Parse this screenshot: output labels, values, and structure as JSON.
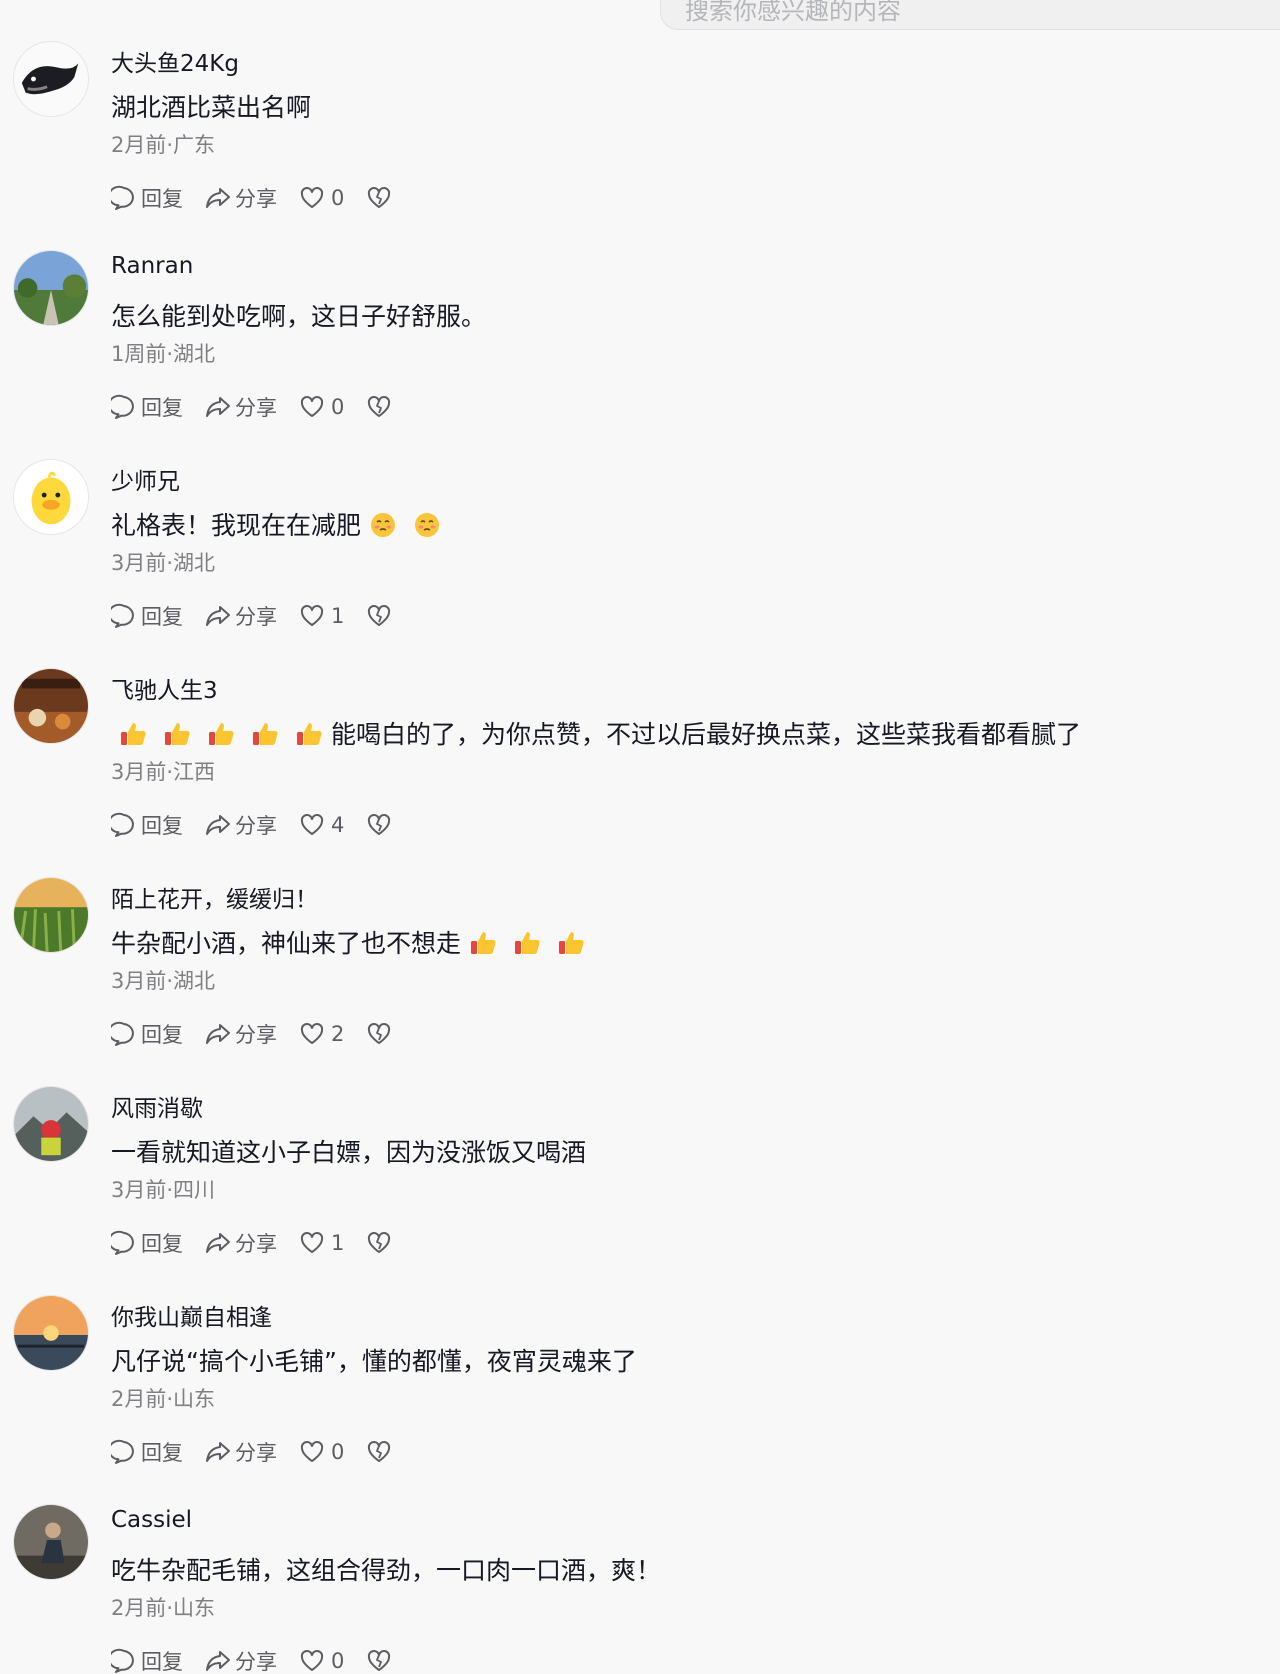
{
  "search": {
    "placeholder": "搜索你感兴趣的内容"
  },
  "actions": {
    "reply": "回复",
    "share": "分享"
  },
  "comments": [
    {
      "author": "大头鱼24Kg",
      "text": "湖北酒比菜出名啊",
      "meta": "2月前·广东",
      "likes": "0",
      "avatar": "fish-avatar"
    },
    {
      "author": "Ranran",
      "text": "怎么能到处吃啊，这日子好舒服。",
      "meta": "1周前·湖北",
      "likes": "0",
      "avatar": "park-avatar"
    },
    {
      "author": "少师兄",
      "text": "礼格表！我现在在减肥",
      "emoji": "pleading-face",
      "emoji_count": 2,
      "meta": "3月前·湖北",
      "likes": "1",
      "avatar": "duck-avatar"
    },
    {
      "author": "飞驰人生3",
      "text": "能喝白的了，为你点赞，不过以后最好换点菜，这些菜我看都看腻了",
      "emoji": "thumbs-up",
      "emoji_count": 5,
      "emoji_position": "before",
      "meta": "3月前·江西",
      "likes": "4",
      "avatar": "restaurant-avatar"
    },
    {
      "author": "陌上花开，缓缓归！",
      "text": "牛杂配小酒，神仙来了也不想走",
      "emoji": "thumbs-up",
      "emoji_count": 3,
      "meta": "3月前·湖北",
      "likes": "2",
      "avatar": "rice-field-avatar"
    },
    {
      "author": "风雨消歇",
      "text": "一看就知道这小子白嫖，因为没涨饭又喝酒",
      "meta": "3月前·四川",
      "likes": "1",
      "avatar": "mountain-avatar"
    },
    {
      "author": "你我山巅自相逢",
      "text": "凡仔说“搞个小毛铺”，懂的都懂，夜宵灵魂来了",
      "meta": "2月前·山东",
      "likes": "0",
      "avatar": "sunset-avatar"
    },
    {
      "author": "Cassiel",
      "text": "吃牛杂配毛铺，这组合得劲，一口肉一口酒，爽！",
      "meta": "2月前·山东",
      "likes": "0",
      "avatar": "person-avatar"
    }
  ],
  "colors": {
    "background": "#f8f8f8",
    "text": "#161823",
    "meta": "#808084",
    "icon": "#5c5d62"
  }
}
